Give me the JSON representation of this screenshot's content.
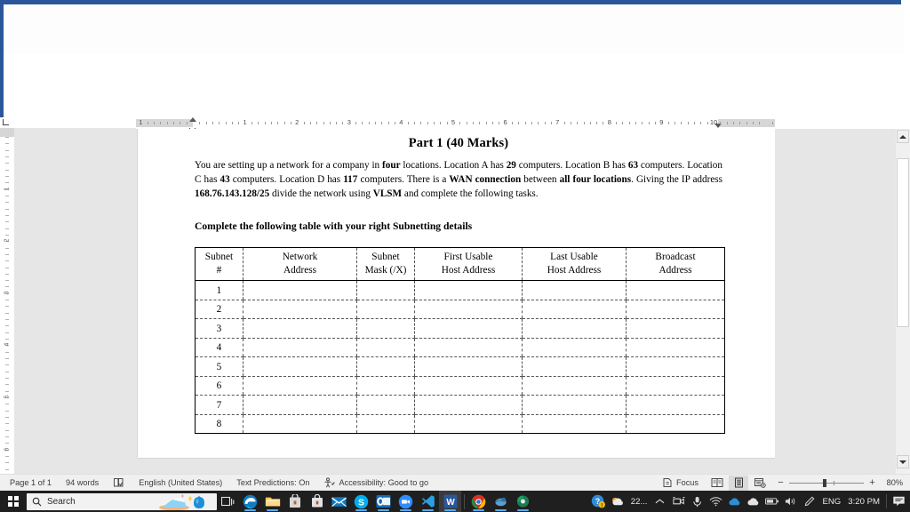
{
  "document": {
    "title": "Part 1 (40 Marks)",
    "paragraph_runs": [
      {
        "t": "You are setting up a network for a company in ",
        "b": false
      },
      {
        "t": "four",
        "b": true
      },
      {
        "t": " locations. Location A has ",
        "b": false
      },
      {
        "t": "29",
        "b": true
      },
      {
        "t": " computers. Location B has ",
        "b": false
      },
      {
        "t": "63",
        "b": true
      },
      {
        "t": " computers. Location C has ",
        "b": false
      },
      {
        "t": "43",
        "b": true
      },
      {
        "t": " computers. Location D has ",
        "b": false
      },
      {
        "t": "117",
        "b": true
      },
      {
        "t": " computers. There is a ",
        "b": false
      },
      {
        "t": "WAN connection",
        "b": true
      },
      {
        "t": " between ",
        "b": false
      },
      {
        "t": "all four locations",
        "b": true
      },
      {
        "t": ". Giving the IP address ",
        "b": false
      },
      {
        "t": "168.76.143.128/25",
        "b": true
      },
      {
        "t": " divide the network using ",
        "b": false
      },
      {
        "t": "VLSM",
        "b": true
      },
      {
        "t": " and complete the following tasks.",
        "b": false
      }
    ],
    "subheading": "Complete the following table with your right Subnetting details",
    "table": {
      "headers": [
        [
          "Subnet",
          "#"
        ],
        [
          "Network",
          "Address"
        ],
        [
          "Subnet",
          "Mask (/X)"
        ],
        [
          "First Usable",
          "Host Address"
        ],
        [
          "Last Usable",
          "Host Address"
        ],
        [
          "Broadcast",
          "Address"
        ]
      ],
      "rows": [
        [
          "1",
          "",
          "",
          "",
          "",
          ""
        ],
        [
          "2",
          "",
          "",
          "",
          "",
          ""
        ],
        [
          "3",
          "",
          "",
          "",
          "",
          ""
        ],
        [
          "4",
          "",
          "",
          "",
          "",
          ""
        ],
        [
          "5",
          "",
          "",
          "",
          "",
          ""
        ],
        [
          "6",
          "",
          "",
          "",
          "",
          ""
        ],
        [
          "7",
          "",
          "",
          "",
          "",
          ""
        ],
        [
          "8",
          "",
          "",
          "",
          "",
          ""
        ]
      ]
    }
  },
  "rulers": {
    "horizontal_numbers": [
      "1",
      "1",
      "2",
      "3",
      "4",
      "5",
      "6",
      "7",
      "8",
      "9",
      "10"
    ],
    "vertical_numbers": [
      "1",
      "2",
      "3",
      "4",
      "5",
      "6"
    ]
  },
  "statusbar": {
    "page": "Page 1 of 1",
    "words": "94 words",
    "proofing_icon": "proofing-errors-icon",
    "language": "English (United States)",
    "text_predictions": "Text Predictions: On",
    "accessibility_icon": "accessibility-icon",
    "accessibility": "Accessibility: Good to go",
    "focus_icon": "focus-icon",
    "focus": "Focus",
    "view_read_icon": "read-mode-icon",
    "view_print_icon": "print-layout-icon",
    "view_web_icon": "web-layout-icon",
    "zoom_out_icon": "zoom-out-icon",
    "zoom_in_icon": "zoom-in-icon",
    "zoom_percent": "80%"
  },
  "taskbar": {
    "start_icon": "windows-start-icon",
    "search_icon": "search-icon",
    "search_placeholder": "Search",
    "taskview_icon": "task-view-icon",
    "apps": [
      {
        "name": "edge-icon"
      },
      {
        "name": "file-explorer-icon"
      },
      {
        "name": "store-icon"
      },
      {
        "name": "toolbox-icon"
      },
      {
        "name": "mail-icon"
      },
      {
        "name": "skype-icon"
      },
      {
        "name": "outlook-icon"
      },
      {
        "name": "zoom-app-icon"
      },
      {
        "name": "vscode-icon"
      },
      {
        "name": "word-icon"
      },
      {
        "name": "chrome-icon"
      },
      {
        "name": "wireshark-icon"
      },
      {
        "name": "packet-tracer-icon"
      }
    ],
    "tray": {
      "help_icon": "help-warning-icon",
      "weather_icon": "weather-cloud-icon",
      "weather_temp": "22...",
      "chevron_icon": "chevron-up-icon",
      "camera_icon": "camera-icon",
      "mic_icon": "microphone-icon",
      "network_icon": "wifi-icon",
      "onedrive_icon": "onedrive-icon",
      "cloud_icon": "cloud-icon",
      "battery_icon": "battery-icon",
      "volume_icon": "volume-icon",
      "pen_icon": "pen-icon",
      "language": "ENG",
      "time": "3:20 PM",
      "notification_icon": "notifications-icon"
    }
  },
  "colors": {
    "word_blue": "#2b579a",
    "page_bg": "#e6e6e6",
    "taskbar_bg": "#1f1f1f",
    "statusbar_bg": "#f0f0f0"
  }
}
